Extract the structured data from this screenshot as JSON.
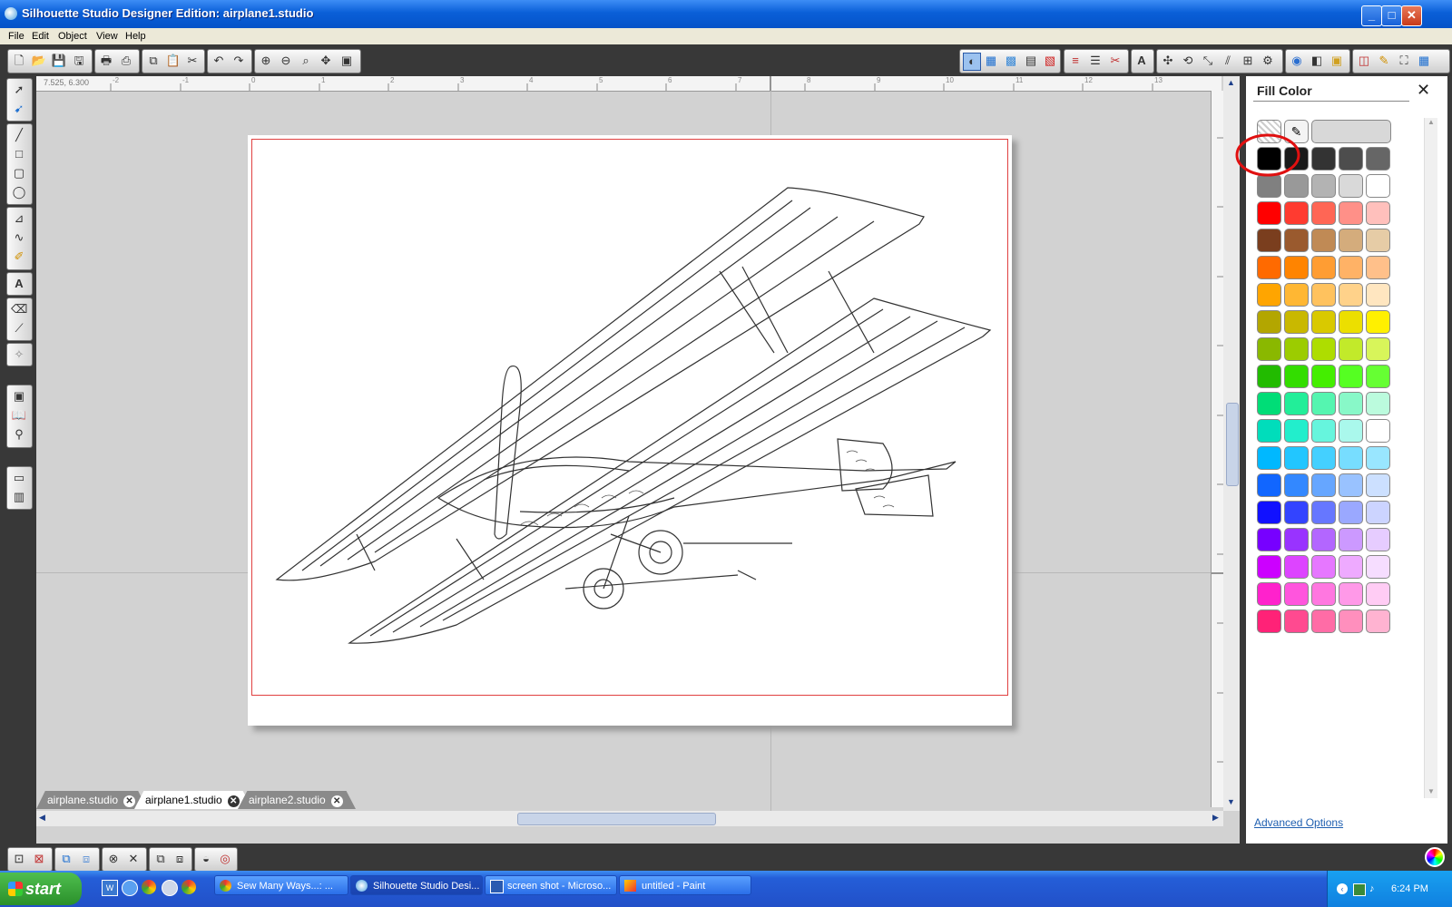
{
  "window": {
    "title": "Silhouette Studio Designer Edition: airplane1.studio"
  },
  "menu": [
    "File",
    "Edit",
    "Object",
    "View",
    "Help"
  ],
  "toolbar": {
    "left_icons": [
      "new-icon",
      "open-icon",
      "save-icon",
      "save-as-icon",
      "print-icon",
      "cut-send-icon",
      "copy-icon",
      "paste-icon",
      "scissors-icon",
      "undo-icon",
      "redo-icon",
      "zoom-in-icon",
      "zoom-out-icon",
      "zoom-select-icon",
      "pan-icon",
      "fit-page-icon"
    ],
    "right_icons": [
      "fill-color-icon",
      "fill-gradient-icon",
      "fill-pattern-icon",
      "line-style-icon",
      "line-color-icon",
      "cut-style-icon",
      "text-style-icon",
      "transform-icon",
      "rotate-icon",
      "scale-icon",
      "shear-icon",
      "align-icon",
      "replicate-icon",
      "trace-icon",
      "offset-icon",
      "page-settings-icon",
      "cut-settings-icon",
      "pencil-icon",
      "fullscreen-icon",
      "grid-icon"
    ]
  },
  "ruler": {
    "readout": "7.525, 6.300",
    "ticks": [
      "-2",
      "-1",
      "0",
      "1",
      "2",
      "3",
      "4",
      "5",
      "6",
      "7",
      "8",
      "9",
      "10",
      "11",
      "12",
      "13"
    ]
  },
  "tabs": [
    {
      "label": "airplane.studio",
      "active": false
    },
    {
      "label": "airplane1.studio",
      "active": true
    },
    {
      "label": "airplane2.studio",
      "active": false
    }
  ],
  "fill_panel": {
    "title": "Fill Color",
    "advanced": "Advanced Options",
    "selected_swatch": "#000000",
    "colors": [
      [
        "#000000",
        "#1a1a1a",
        "#333333",
        "#4d4d4d",
        "#666666"
      ],
      [
        "#808080",
        "#999999",
        "#b3b3b3",
        "#d9d9d9",
        "#ffffff"
      ],
      [
        "#ff0000",
        "#ff3b30",
        "#ff6655",
        "#ff9088",
        "#ffc0bc"
      ],
      [
        "#7a3e1e",
        "#9a5a2e",
        "#c08a55",
        "#d4ac7c",
        "#e6cca6"
      ],
      [
        "#ff6a00",
        "#ff8400",
        "#ff9d33",
        "#ffb266",
        "#ffc08a"
      ],
      [
        "#ffa500",
        "#ffb733",
        "#ffc25e",
        "#ffd28a",
        "#ffe6c0"
      ],
      [
        "#b3a600",
        "#c9b800",
        "#d9c900",
        "#ecdf00",
        "#fff000"
      ],
      [
        "#8ab800",
        "#9ccc00",
        "#aedd00",
        "#c2ea2a",
        "#d8f55a"
      ],
      [
        "#22bb00",
        "#33dd00",
        "#44ee00",
        "#55ff22",
        "#66ff33"
      ],
      [
        "#00dd77",
        "#22ee99",
        "#55f5b0",
        "#88f8c8",
        "#bbfbdd"
      ],
      [
        "#00ddbb",
        "#22eecc",
        "#66f5dd",
        "#aaf8ec",
        "#ffffff"
      ],
      [
        "#00b8ff",
        "#22c6ff",
        "#44d0ff",
        "#77ddff",
        "#99e6ff"
      ],
      [
        "#1166ff",
        "#3388ff",
        "#66a6ff",
        "#99c2ff",
        "#cce0ff"
      ],
      [
        "#1111ff",
        "#3344ff",
        "#6677ff",
        "#9aa8ff",
        "#ccd4ff"
      ],
      [
        "#7700ff",
        "#9933ff",
        "#b366ff",
        "#cc99ff",
        "#e6ccff"
      ],
      [
        "#cc00ff",
        "#dd44ff",
        "#e677ff",
        "#eeaaff",
        "#f6ddff"
      ],
      [
        "#ff22cc",
        "#ff55dd",
        "#ff77e0",
        "#ff99e8",
        "#ffccf4"
      ],
      [
        "#ff2277",
        "#ff4a90",
        "#ff6ca6",
        "#ff8fbd",
        "#ffb3d1"
      ]
    ]
  },
  "taskbar": {
    "start": "start",
    "tasks": [
      {
        "label": "Sew Many Ways...: ...",
        "icon": "chrome-icon",
        "active": false
      },
      {
        "label": "Silhouette Studio Desi...",
        "icon": "silhouette-icon",
        "active": true
      },
      {
        "label": "screen shot - Microso...",
        "icon": "word-icon",
        "active": false
      },
      {
        "label": "untitled - Paint",
        "icon": "paint-icon",
        "active": false
      }
    ],
    "clock": "6:24 PM"
  }
}
